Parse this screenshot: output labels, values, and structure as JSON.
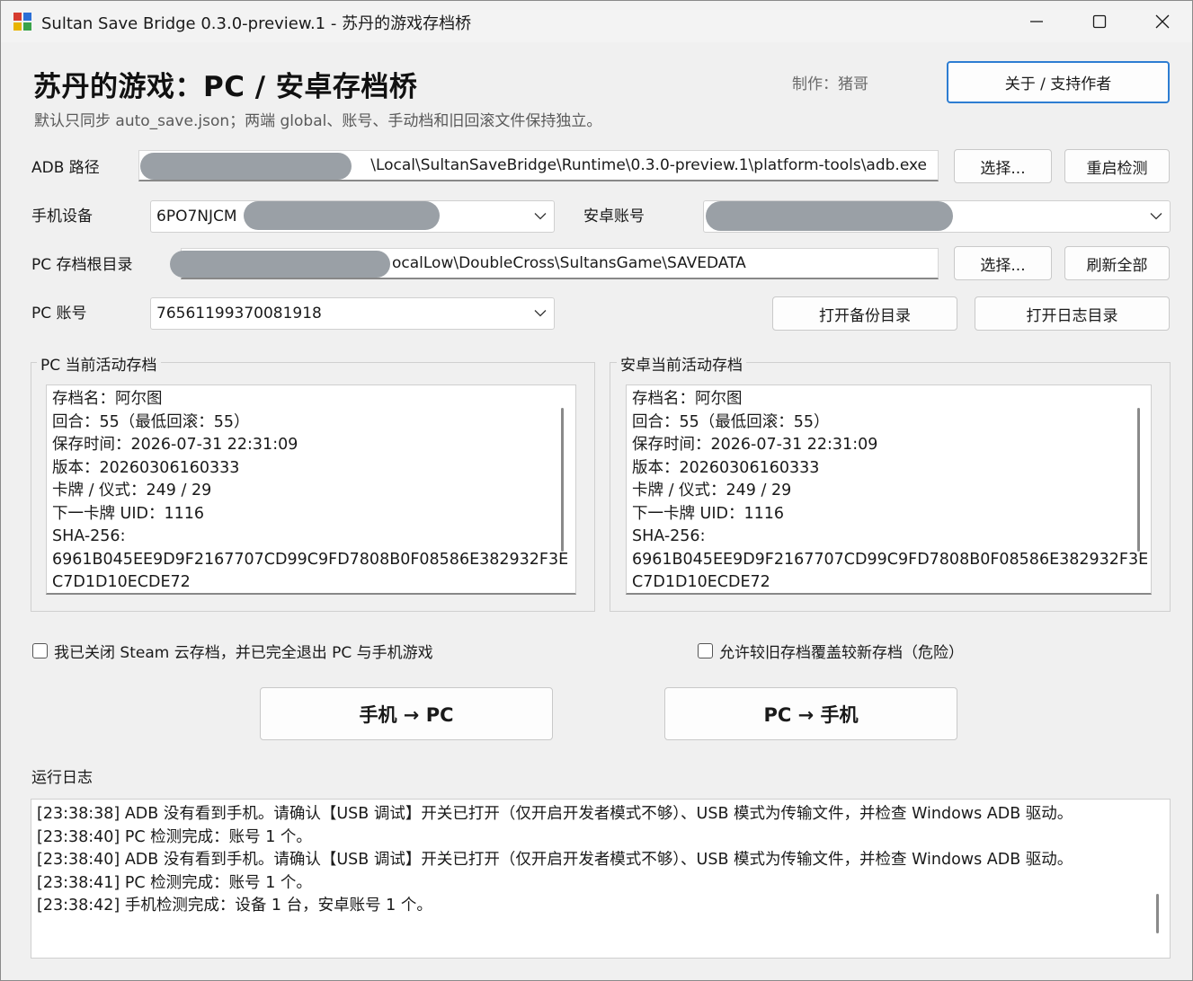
{
  "window": {
    "title": "Sultan Save Bridge 0.3.0-preview.1 - 苏丹的游戏存档桥"
  },
  "header": {
    "heading": "苏丹的游戏：PC / 安卓存档桥",
    "subtitle": "默认只同步 auto_save.json；两端 global、账号、手动档和旧回滚文件保持独立。",
    "author": "制作：猪哥",
    "about_button": "关于 / 支持作者"
  },
  "adb": {
    "label": "ADB 路径",
    "path_visible": "\\Local\\SultanSaveBridge\\Runtime\\0.3.0-preview.1\\platform-tools\\adb.exe",
    "select_button": "选择...",
    "restart_button": "重启检测"
  },
  "device": {
    "label": "手机设备",
    "value_visible": "6PO7NJCM",
    "android_account_label": "安卓账号",
    "android_account_value": ""
  },
  "pc_root": {
    "label": "PC 存档根目录",
    "path_visible": "ocalLow\\DoubleCross\\SultansGame\\SAVEDATA",
    "select_button": "选择...",
    "refresh_button": "刷新全部"
  },
  "pc_account": {
    "label": "PC 账号",
    "value": "76561199370081918",
    "open_backup_button": "打开备份目录",
    "open_log_button": "打开日志目录"
  },
  "pc_save": {
    "title": "PC 当前活动存档",
    "lines": [
      "存档名：阿尔图",
      "回合：55（最低回滚：55）",
      "保存时间：2026-07-31 22:31:09",
      "版本：20260306160333",
      "卡牌 / 仪式：249 / 29",
      "下一卡牌 UID：1116",
      "SHA-256:",
      "6961B045EE9D9F2167707CD99C9FD7808B0F08586E382932F3E",
      "C7D1D10ECDE72"
    ]
  },
  "android_save": {
    "title": "安卓当前活动存档",
    "lines": [
      "存档名：阿尔图",
      "回合：55（最低回滚：55）",
      "保存时间：2026-07-31 22:31:09",
      "版本：20260306160333",
      "卡牌 / 仪式：249 / 29",
      "下一卡牌 UID：1116",
      "SHA-256:",
      "6961B045EE9D9F2167707CD99C9FD7808B0F08586E382932F3E",
      "C7D1D10ECDE72"
    ]
  },
  "options": {
    "confirm_closed": "我已关闭 Steam 云存档，并已完全退出 PC 与手机游戏",
    "allow_older": "允许较旧存档覆盖较新存档（危险）"
  },
  "actions": {
    "phone_to_pc": "手机 → PC",
    "pc_to_phone": "PC → 手机"
  },
  "log": {
    "label": "运行日志",
    "lines": [
      "[23:38:38] ADB 没有看到手机。请确认【USB 调试】开关已打开（仅开启开发者模式不够）、USB 模式为传输文件，并检查 Windows ADB 驱动。",
      "[23:38:40] PC 检测完成：账号 1 个。",
      "[23:38:40] ADB 没有看到手机。请确认【USB 调试】开关已打开（仅开启开发者模式不够）、USB 模式为传输文件，并检查 Windows ADB 驱动。",
      "[23:38:41] PC 检测完成：账号 1 个。",
      "[23:38:42] 手机检测完成：设备 1 台，安卓账号 1 个。"
    ]
  },
  "colors": {
    "accent": "#2d7dd2",
    "background": "#f0f0f0",
    "redaction": "#9aa0a6"
  }
}
